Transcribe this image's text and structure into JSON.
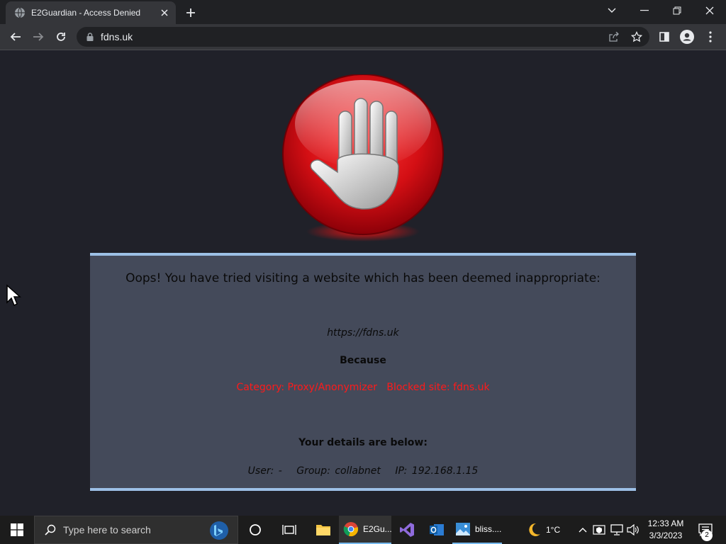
{
  "browser": {
    "tab": {
      "title": "E2Guardian - Access Denied"
    },
    "address_bar": {
      "url": "fdns.uk"
    }
  },
  "block_page": {
    "headline": "Oops! You have tried visiting a website which has been deemed inappropriate:",
    "blocked_url": "https://fdns.uk",
    "because_label": "Because",
    "reason": "Category: Proxy/Anonymizer   Blocked site: fdns.uk",
    "details_heading": "Your details are below:",
    "details": {
      "user": "User: -",
      "group": "Group: collabnet",
      "ip": "IP: 192.168.1.15"
    }
  },
  "taskbar": {
    "search_placeholder": "Type here to search",
    "apps": [
      {
        "label": "E2Gu...",
        "icon": "chrome-icon",
        "active": true
      },
      {
        "label": "bliss....",
        "icon": "photos-icon",
        "active": false
      }
    ],
    "weather": {
      "temperature": "1°C",
      "icon": "moon-icon"
    },
    "clock": {
      "time": "12:33 AM",
      "date": "3/3/2023"
    },
    "notification_count": "2"
  },
  "colors": {
    "page_background": "#202129",
    "panel_background": "#444a5a",
    "panel_border": "#9dc0e6",
    "reason_text": "#ff1a1a"
  }
}
